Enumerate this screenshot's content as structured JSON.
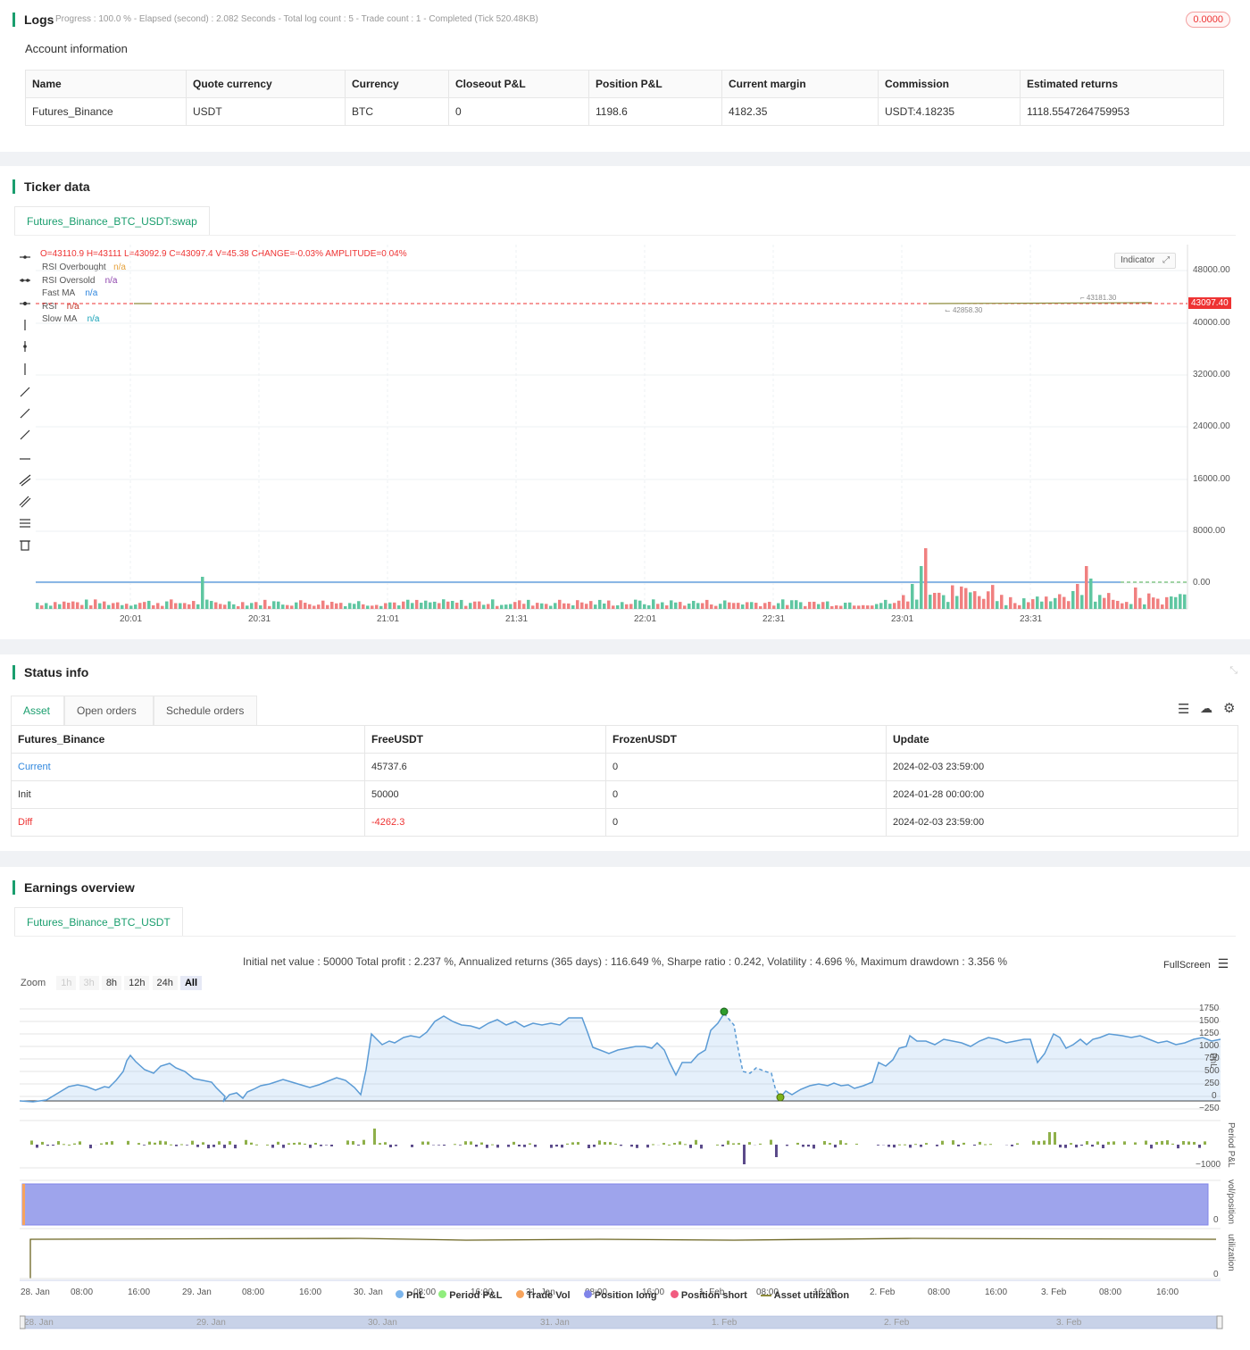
{
  "logs": {
    "title": "Logs",
    "status_line": "Progress : 100.0 % - Elapsed (second) : 2.082  Seconds - Total log count : 5 - Trade count : 1 - Completed (Tick 520.48KB)",
    "badge": "0.0000"
  },
  "account": {
    "title": "Account information",
    "headers": [
      "Name",
      "Quote currency",
      "Currency",
      "Closeout P&L",
      "Position P&L",
      "Current margin",
      "Commission",
      "Estimated returns"
    ],
    "row": [
      "Futures_Binance",
      "USDT",
      "BTC",
      "0",
      "1198.6",
      "4182.35",
      "USDT:4.18235",
      "1118.5547264759953"
    ]
  },
  "ticker": {
    "title": "Ticker data",
    "tab": "Futures_Binance_BTC_USDT:swap",
    "ohlc": {
      "o": "O=43110.9",
      "h": "H=43111",
      "l": "L=43092.9",
      "c": "C=43097.4",
      "v": "V=45.38",
      "change": "CHANGE=-0.03%",
      "amplitude": "AMPLITUDE=0.04%"
    },
    "indicator_button": "Indicator",
    "legend": [
      {
        "name": "RSI Overbought",
        "value": "n/a",
        "color": "#e6a23c"
      },
      {
        "name": "RSI Oversold",
        "value": "n/a",
        "color": "#8e44ad"
      },
      {
        "name": "Fast MA",
        "value": "n/a",
        "color": "#2e86de"
      },
      {
        "name": "RSI",
        "value": "n/a",
        "color": "#c0392b"
      },
      {
        "name": "Slow MA",
        "value": "n/a",
        "color": "#17a2b8"
      }
    ],
    "price_axis": [
      "48000.00",
      "40000.00",
      "32000.00",
      "24000.00",
      "16000.00",
      "8000.00",
      "0.00"
    ],
    "price_tag": "43097.40",
    "high_mark": "43181.30",
    "low_mark": "42858.30",
    "time_axis": [
      "20:01",
      "20:31",
      "21:01",
      "21:31",
      "22:01",
      "22:31",
      "23:01",
      "23:31"
    ]
  },
  "status": {
    "title": "Status info",
    "tabs": [
      "Asset",
      "Open orders",
      "Schedule orders"
    ],
    "headers": [
      "Futures_Binance",
      "FreeUSDT",
      "FrozenUSDT",
      "Update"
    ],
    "rows": [
      [
        "Current",
        "45737.6",
        "0",
        "2024-02-03 23:59:00"
      ],
      [
        "Init",
        "50000",
        "0",
        "2024-01-28 00:00:00"
      ],
      [
        "Diff",
        "-4262.3",
        "0",
        "2024-02-03 23:59:00"
      ]
    ]
  },
  "earnings": {
    "title": "Earnings overview",
    "tab": "Futures_Binance_BTC_USDT",
    "summary": "Initial net value : 50000 Total profit : 2.237 %, Annualized returns (365 days) : 116.649 %, Sharpe ratio : 0.242, Volatility : 4.696 %, Maximum drawdown : 3.356 %",
    "fullscreen": "FullScreen",
    "zoom_label": "Zoom",
    "zoom_buttons": [
      "1h",
      "3h",
      "8h",
      "12h",
      "24h",
      "All"
    ],
    "pnl_axis": [
      "1750",
      "1500",
      "1250",
      "1000",
      "750",
      "500",
      "250",
      "0",
      "−250"
    ],
    "pnl_axis_label": "PnL",
    "period_axis": [
      "−1000"
    ],
    "period_axis_label": "Period P&L",
    "vol_axis": [
      "0"
    ],
    "vol_axis_label": "vol/position",
    "util_axis": [
      "0"
    ],
    "util_axis_label": "utilization",
    "x_axis": [
      "28. Jan",
      "08:00",
      "16:00",
      "29. Jan",
      "08:00",
      "16:00",
      "30. Jan",
      "08:00",
      "16:00",
      "31. Jan",
      "08:00",
      "16:00",
      "1. Feb",
      "08:00",
      "16:00",
      "2. Feb",
      "08:00",
      "16:00",
      "3. Feb",
      "08:00",
      "16:00"
    ],
    "legend": [
      {
        "name": "PnL",
        "color": "#7cb5ec"
      },
      {
        "name": "Period P&L",
        "color": "#90ed7d"
      },
      {
        "name": "Trade Vol",
        "color": "#f7a35c"
      },
      {
        "name": "Position long",
        "color": "#8085e9"
      },
      {
        "name": "Position short",
        "color": "#f15c80"
      },
      {
        "name": "Asset utilization",
        "color": "#8d8b3a"
      }
    ],
    "navigator": [
      "28. Jan",
      "29. Jan",
      "30. Jan",
      "31. Jan",
      "1. Feb",
      "2. Feb",
      "3. Feb"
    ]
  }
}
